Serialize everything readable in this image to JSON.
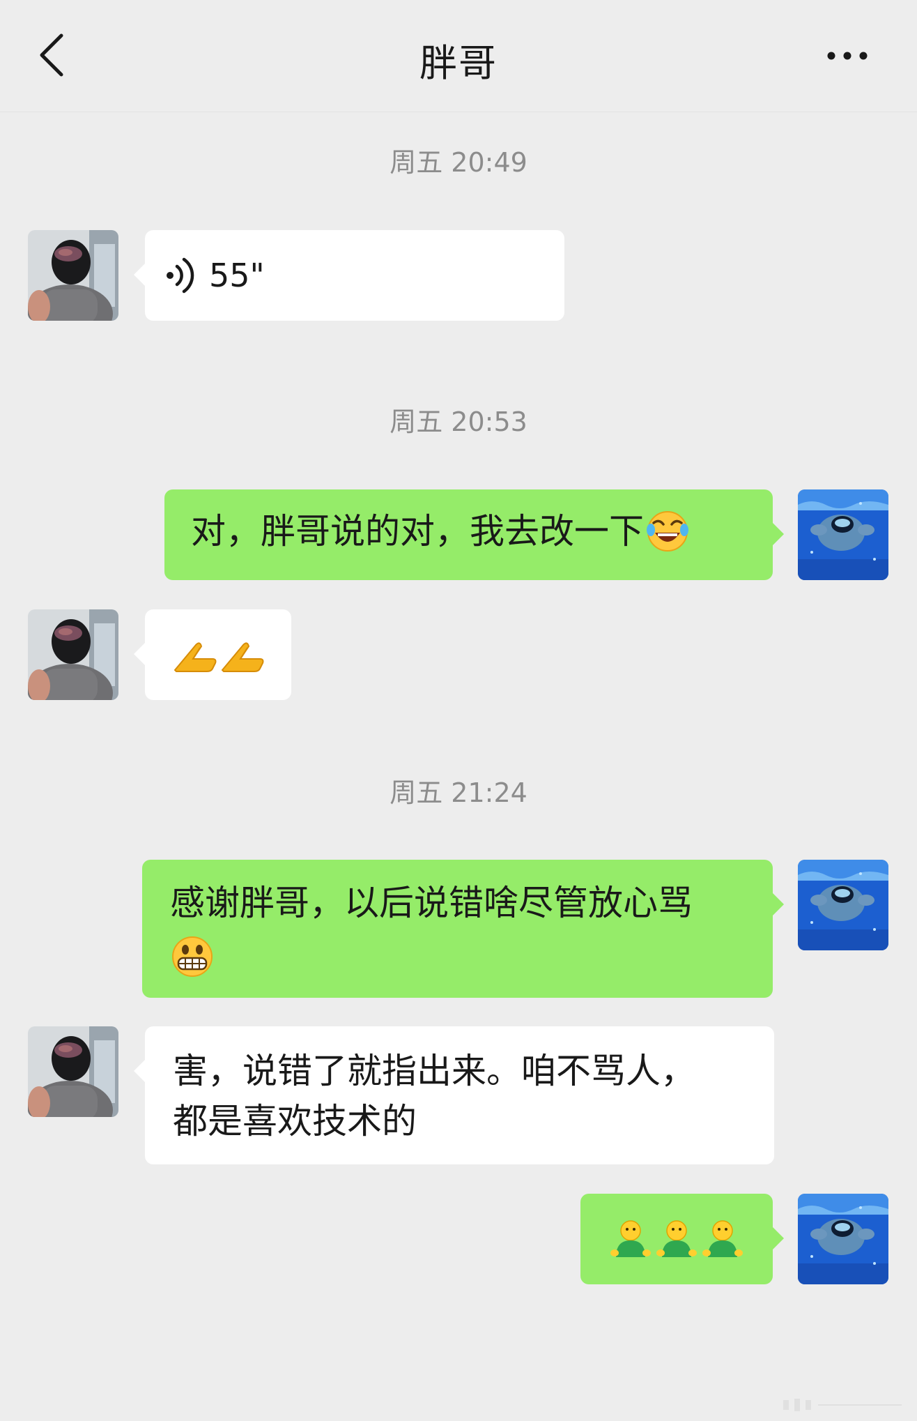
{
  "header": {
    "title": "胖哥",
    "back_icon": "chevron-left-icon",
    "more_icon": "more-dots-icon"
  },
  "timestamps": [
    "周五 20:49",
    "周五 20:53",
    "周五 21:24"
  ],
  "messages": [
    {
      "from": "other",
      "type": "voice",
      "duration": "55\""
    },
    {
      "from": "me",
      "type": "text",
      "text": "对，胖哥说的对，我去改一下",
      "emoji": "laughing-tears-emoji"
    },
    {
      "from": "other",
      "type": "emoji",
      "emoji": "clasped-hands-emoji"
    },
    {
      "from": "me",
      "type": "text",
      "text": "感谢胖哥，以后说错啥尽管放心骂",
      "emoji": "grimacing-emoji"
    },
    {
      "from": "other",
      "type": "text",
      "line1": "害，说错了就指出来。咱不骂人，",
      "line2": "都是喜欢技术的"
    },
    {
      "from": "me",
      "type": "emoji",
      "emoji": "green-figure-emoji"
    }
  ],
  "colors": {
    "background": "#ededed",
    "incoming_bubble": "#ffffff",
    "outgoing_bubble": "#95ec69",
    "timestamp_text": "#8c8c8c"
  }
}
